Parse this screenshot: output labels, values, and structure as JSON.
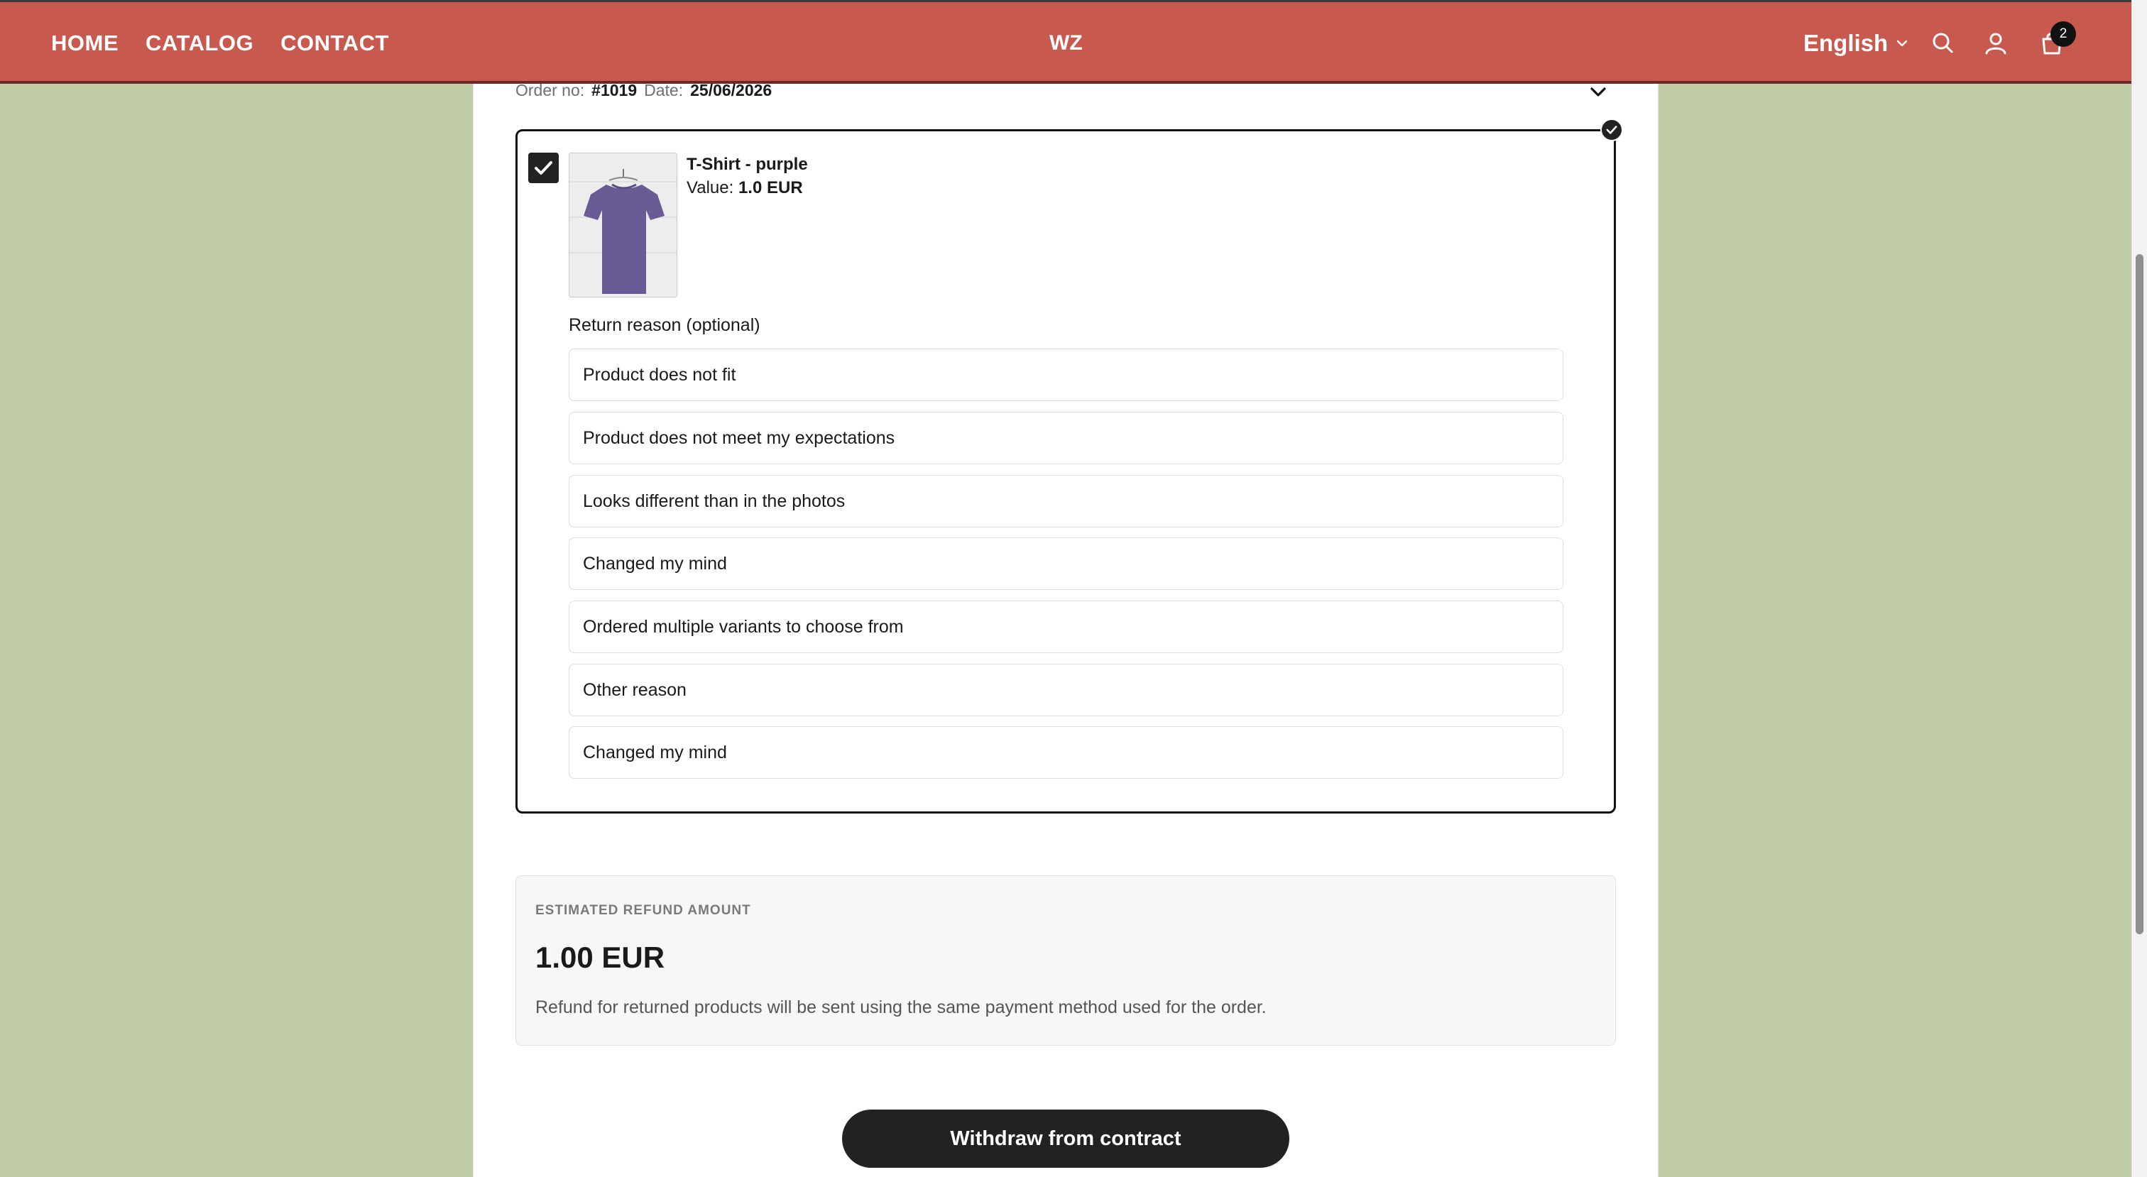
{
  "header": {
    "nav": [
      "HOME",
      "CATALOG",
      "CONTACT"
    ],
    "logo": "WZ",
    "language": "English",
    "cart_count": "2",
    "icons": [
      "search-icon",
      "user-icon",
      "cart-icon",
      "chevron-down-icon"
    ],
    "background_color": "#c8594f"
  },
  "order": {
    "number_label": "Order no:",
    "number": "#1019",
    "date_label": "Date:",
    "date": "25/06/2026"
  },
  "item": {
    "name": "T-Shirt - purple",
    "value_label": "Value:",
    "value": "1.0 EUR",
    "selected": true
  },
  "return_reason": {
    "label": "Return reason (optional)",
    "options": [
      "Product does not fit",
      "Product does not meet my expectations",
      "Looks different than in the photos",
      "Changed my mind",
      "Ordered multiple variants to choose from",
      "Other reason",
      "Changed my mind"
    ]
  },
  "refund": {
    "label": "ESTIMATED REFUND AMOUNT",
    "amount": "1.00 EUR",
    "note": "Refund for returned products will be sent using the same payment method used for the order."
  },
  "actions": {
    "withdraw": "Withdraw from contract"
  },
  "colors": {
    "page_background": "#c0cca6",
    "accent_dark": "#222222",
    "shirt": "#6a5a96"
  }
}
